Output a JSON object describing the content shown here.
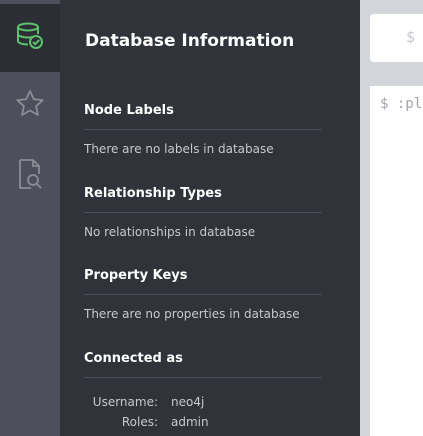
{
  "nav": {
    "items": [
      {
        "icon": "database-icon",
        "active": true
      },
      {
        "icon": "star-icon",
        "active": false
      },
      {
        "icon": "document-search-icon",
        "active": false
      }
    ]
  },
  "drawer": {
    "title": "Database Information",
    "node_labels": {
      "header": "Node Labels",
      "text": "There are no labels in database"
    },
    "relationship_types": {
      "header": "Relationship Types",
      "text": "No relationships in database"
    },
    "property_keys": {
      "header": "Property Keys",
      "text": "There are no properties in database"
    },
    "connected_as": {
      "header": "Connected as",
      "username_label": "Username:",
      "username_value": "neo4j",
      "roles_label": "Roles:",
      "roles_value": "admin"
    }
  },
  "editor": {
    "prompt": "$",
    "frame_command": "$ :pl"
  },
  "colors": {
    "accent": "#5dc26d",
    "nav_bg": "#4d4f5a",
    "drawer_bg": "#30333a"
  }
}
